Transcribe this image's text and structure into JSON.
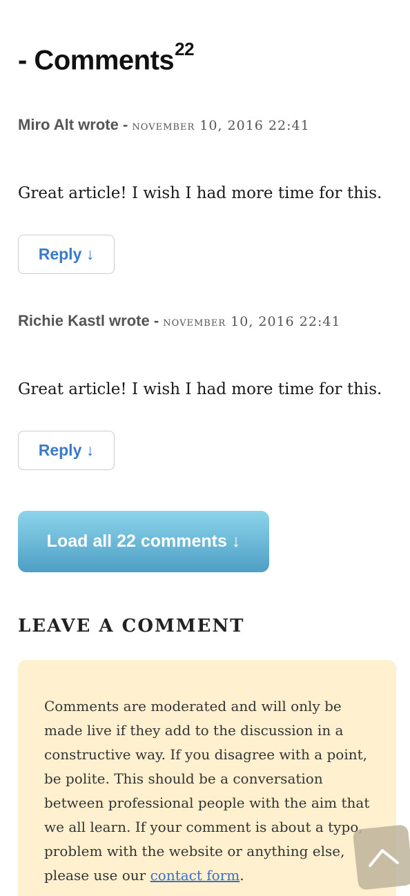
{
  "comments_section": {
    "title": "- Comments",
    "count": "22"
  },
  "comments": [
    {
      "author_line": "Miro Alt wrote - ",
      "date": "November 10, 2016 22:41",
      "body": "Great article! I wish I had more time for this.",
      "reply_label": "Reply ↓"
    },
    {
      "author_line": "Richie Kastl wrote - ",
      "date": "November 10, 2016 22:41",
      "body": "Great article! I wish I had more time for this.",
      "reply_label": "Reply ↓"
    }
  ],
  "load_all": {
    "label": "Load all 22 comments ↓"
  },
  "leave_comment": {
    "title": "LEAVE A COMMENT",
    "notice_text": "Comments are moderated and will only be made live if they add to the discussion in a constructive way. If you disagree with a point, be polite. This should be a conversation between professional people with the aim that we all learn. If your comment is about a typo, problem with the website or anything else, please use our ",
    "contact_link": "contact form",
    "notice_end": "."
  },
  "icons": {
    "scroll_top": "chevron-up-icon"
  },
  "colors": {
    "link": "#3a7bc8",
    "load_button_top": "#8cd4ea",
    "load_button_bottom": "#4e9fc5",
    "notice_background": "#fff0cf"
  }
}
